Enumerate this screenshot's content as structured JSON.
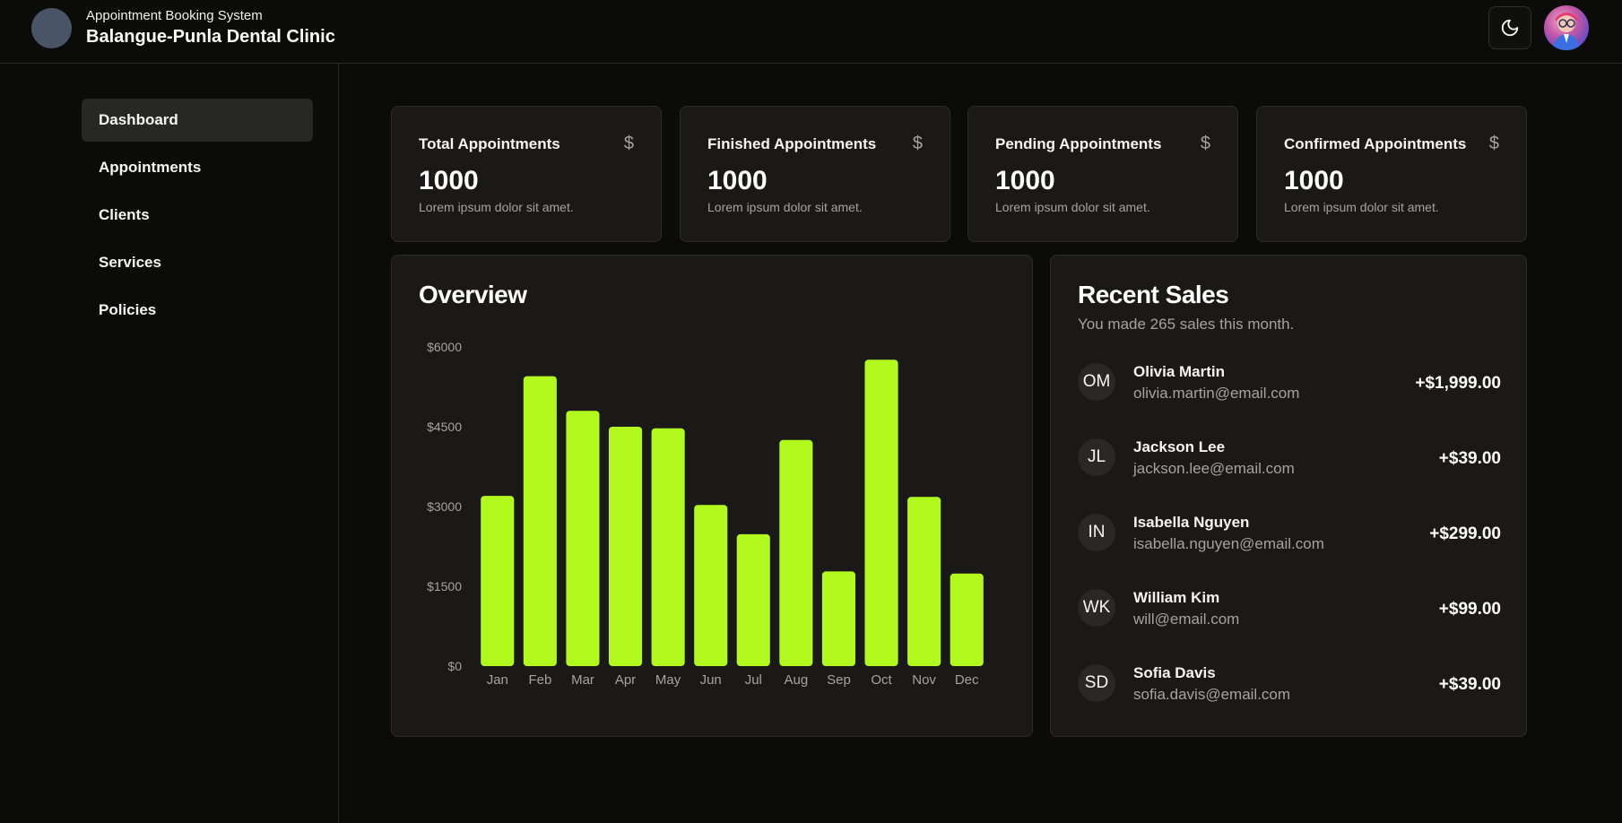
{
  "header": {
    "subtitle": "Appointment Booking System",
    "title": "Balangue-Punla Dental Clinic",
    "theme_icon": "moon-icon"
  },
  "sidebar": {
    "items": [
      {
        "label": "Dashboard",
        "active": true
      },
      {
        "label": "Appointments"
      },
      {
        "label": "Clients"
      },
      {
        "label": "Services"
      },
      {
        "label": "Policies"
      }
    ]
  },
  "stats": [
    {
      "title": "Total Appointments",
      "value": "1000",
      "desc": "Lorem ipsum dolor sit amet.",
      "icon": "dollar-icon"
    },
    {
      "title": "Finished Appointments",
      "value": "1000",
      "desc": "Lorem ipsum dolor sit amet.",
      "icon": "dollar-icon"
    },
    {
      "title": "Pending Appointments",
      "value": "1000",
      "desc": "Lorem ipsum dolor sit amet.",
      "icon": "dollar-icon"
    },
    {
      "title": "Confirmed Appointments",
      "value": "1000",
      "desc": "Lorem ipsum dolor sit amet.",
      "icon": "dollar-icon"
    }
  ],
  "overview": {
    "title": "Overview"
  },
  "chart_data": {
    "type": "bar",
    "categories": [
      "Jan",
      "Feb",
      "Mar",
      "Apr",
      "May",
      "Jun",
      "Jul",
      "Aug",
      "Sep",
      "Oct",
      "Nov",
      "Dec"
    ],
    "values": [
      3200,
      5450,
      4800,
      4500,
      4470,
      3030,
      2480,
      4250,
      1780,
      5760,
      3180,
      1740
    ],
    "yticks": [
      "$0",
      "$1500",
      "$3000",
      "$4500",
      "$6000"
    ],
    "ylim": [
      0,
      6000
    ],
    "bar_color": "#b2fa1e",
    "grid": false
  },
  "recent_sales": {
    "title": "Recent Sales",
    "subtitle": "You made 265 sales this month.",
    "rows": [
      {
        "initials": "OM",
        "name": "Olivia Martin",
        "email": "olivia.martin@email.com",
        "amount": "+$1,999.00"
      },
      {
        "initials": "JL",
        "name": "Jackson Lee",
        "email": "jackson.lee@email.com",
        "amount": "+$39.00"
      },
      {
        "initials": "IN",
        "name": "Isabella Nguyen",
        "email": "isabella.nguyen@email.com",
        "amount": "+$299.00"
      },
      {
        "initials": "WK",
        "name": "William Kim",
        "email": "will@email.com",
        "amount": "+$99.00"
      },
      {
        "initials": "SD",
        "name": "Sofia Davis",
        "email": "sofia.davis@email.com",
        "amount": "+$39.00"
      }
    ]
  }
}
